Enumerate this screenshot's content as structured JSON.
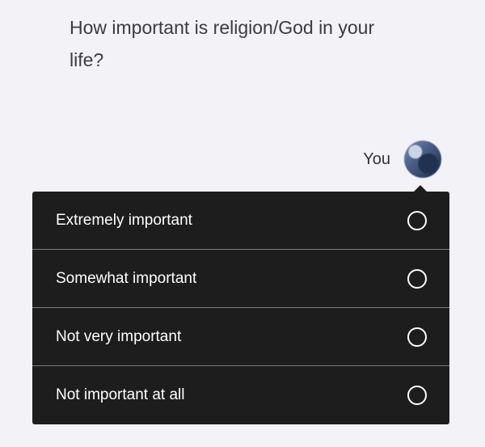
{
  "question": {
    "text": "How important is religion/God in your life?"
  },
  "responder": {
    "label": "You",
    "avatar": "user-avatar"
  },
  "options": [
    {
      "label": "Extremely important",
      "selected": false
    },
    {
      "label": "Somewhat important",
      "selected": false
    },
    {
      "label": "Not very important",
      "selected": false
    },
    {
      "label": "Not important at all",
      "selected": false
    }
  ],
  "colors": {
    "background": "#f2f2f7",
    "panel": "#1d1d1d",
    "question_text": "#3c3c3c",
    "option_text": "#ffffff",
    "divider": "#7a7a7a"
  }
}
